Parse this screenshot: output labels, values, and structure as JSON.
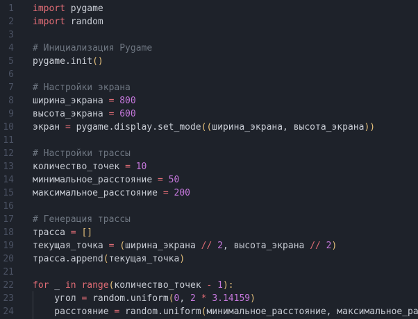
{
  "editor": {
    "lines": [
      {
        "n": "1",
        "tokens": [
          {
            "t": "import",
            "c": "kw"
          },
          {
            "t": " pygame",
            "c": "id"
          }
        ]
      },
      {
        "n": "2",
        "tokens": [
          {
            "t": "import",
            "c": "kw"
          },
          {
            "t": " random",
            "c": "id"
          }
        ]
      },
      {
        "n": "3",
        "tokens": []
      },
      {
        "n": "4",
        "tokens": [
          {
            "t": "# Инициализация Pygame",
            "c": "cm"
          }
        ]
      },
      {
        "n": "5",
        "tokens": [
          {
            "t": "pygame.init",
            "c": "id"
          },
          {
            "t": "()",
            "c": "par"
          }
        ]
      },
      {
        "n": "6",
        "tokens": []
      },
      {
        "n": "7",
        "tokens": [
          {
            "t": "# Настройки экрана",
            "c": "cm"
          }
        ]
      },
      {
        "n": "8",
        "tokens": [
          {
            "t": "ширина_экрана ",
            "c": "id"
          },
          {
            "t": "=",
            "c": "op"
          },
          {
            "t": " ",
            "c": "id"
          },
          {
            "t": "800",
            "c": "num"
          }
        ]
      },
      {
        "n": "9",
        "tokens": [
          {
            "t": "высота_экрана ",
            "c": "id"
          },
          {
            "t": "=",
            "c": "op"
          },
          {
            "t": " ",
            "c": "id"
          },
          {
            "t": "600",
            "c": "num"
          }
        ]
      },
      {
        "n": "10",
        "tokens": [
          {
            "t": "экран ",
            "c": "id"
          },
          {
            "t": "=",
            "c": "op"
          },
          {
            "t": " pygame.display.set_mode",
            "c": "id"
          },
          {
            "t": "((",
            "c": "par"
          },
          {
            "t": "ширина_экрана, высота_экрана",
            "c": "id"
          },
          {
            "t": "))",
            "c": "par"
          }
        ]
      },
      {
        "n": "11",
        "tokens": []
      },
      {
        "n": "12",
        "tokens": [
          {
            "t": "# Настройки трассы",
            "c": "cm"
          }
        ]
      },
      {
        "n": "13",
        "tokens": [
          {
            "t": "количество_точек ",
            "c": "id"
          },
          {
            "t": "=",
            "c": "op"
          },
          {
            "t": " ",
            "c": "id"
          },
          {
            "t": "10",
            "c": "num"
          }
        ]
      },
      {
        "n": "14",
        "tokens": [
          {
            "t": "минимальное_расстояние ",
            "c": "id"
          },
          {
            "t": "=",
            "c": "op"
          },
          {
            "t": " ",
            "c": "id"
          },
          {
            "t": "50",
            "c": "num"
          }
        ]
      },
      {
        "n": "15",
        "tokens": [
          {
            "t": "максимальное_расстояние ",
            "c": "id"
          },
          {
            "t": "=",
            "c": "op"
          },
          {
            "t": " ",
            "c": "id"
          },
          {
            "t": "200",
            "c": "num"
          }
        ]
      },
      {
        "n": "16",
        "tokens": []
      },
      {
        "n": "17",
        "tokens": [
          {
            "t": "# Генерация трассы",
            "c": "cm"
          }
        ]
      },
      {
        "n": "18",
        "tokens": [
          {
            "t": "трасса ",
            "c": "id"
          },
          {
            "t": "=",
            "c": "op"
          },
          {
            "t": " ",
            "c": "id"
          },
          {
            "t": "[]",
            "c": "par"
          }
        ]
      },
      {
        "n": "19",
        "tokens": [
          {
            "t": "текущая_точка ",
            "c": "id"
          },
          {
            "t": "=",
            "c": "op"
          },
          {
            "t": " ",
            "c": "id"
          },
          {
            "t": "(",
            "c": "par"
          },
          {
            "t": "ширина_экрана ",
            "c": "id"
          },
          {
            "t": "//",
            "c": "op"
          },
          {
            "t": " ",
            "c": "id"
          },
          {
            "t": "2",
            "c": "num"
          },
          {
            "t": ", высота_экрана ",
            "c": "id"
          },
          {
            "t": "//",
            "c": "op"
          },
          {
            "t": " ",
            "c": "id"
          },
          {
            "t": "2",
            "c": "num"
          },
          {
            "t": ")",
            "c": "par"
          }
        ]
      },
      {
        "n": "20",
        "tokens": [
          {
            "t": "трасса.append",
            "c": "id"
          },
          {
            "t": "(",
            "c": "par"
          },
          {
            "t": "текущая_точка",
            "c": "id"
          },
          {
            "t": ")",
            "c": "par"
          }
        ]
      },
      {
        "n": "21",
        "tokens": []
      },
      {
        "n": "22",
        "tokens": [
          {
            "t": "for",
            "c": "kw"
          },
          {
            "t": " _ ",
            "c": "id"
          },
          {
            "t": "in",
            "c": "kw"
          },
          {
            "t": " ",
            "c": "id"
          },
          {
            "t": "range",
            "c": "op"
          },
          {
            "t": "(",
            "c": "par"
          },
          {
            "t": "количество_точек ",
            "c": "id"
          },
          {
            "t": "-",
            "c": "op"
          },
          {
            "t": " ",
            "c": "id"
          },
          {
            "t": "1",
            "c": "num"
          },
          {
            "t": "):",
            "c": "par"
          }
        ]
      },
      {
        "n": "23",
        "tokens": [
          {
            "t": "    угол ",
            "c": "id"
          },
          {
            "t": "=",
            "c": "op"
          },
          {
            "t": " random.uniform",
            "c": "id"
          },
          {
            "t": "(",
            "c": "par"
          },
          {
            "t": "0",
            "c": "num"
          },
          {
            "t": ", ",
            "c": "id"
          },
          {
            "t": "2",
            "c": "num"
          },
          {
            "t": " ",
            "c": "id"
          },
          {
            "t": "*",
            "c": "op"
          },
          {
            "t": " ",
            "c": "id"
          },
          {
            "t": "3.14159",
            "c": "num"
          },
          {
            "t": ")",
            "c": "par"
          }
        ]
      },
      {
        "n": "24",
        "tokens": [
          {
            "t": "    расстояние ",
            "c": "id"
          },
          {
            "t": "=",
            "c": "op"
          },
          {
            "t": " random.uniform",
            "c": "id"
          },
          {
            "t": "(",
            "c": "par"
          },
          {
            "t": "минимальное_расстояние, максимальное_расс",
            "c": "id"
          }
        ]
      }
    ]
  }
}
